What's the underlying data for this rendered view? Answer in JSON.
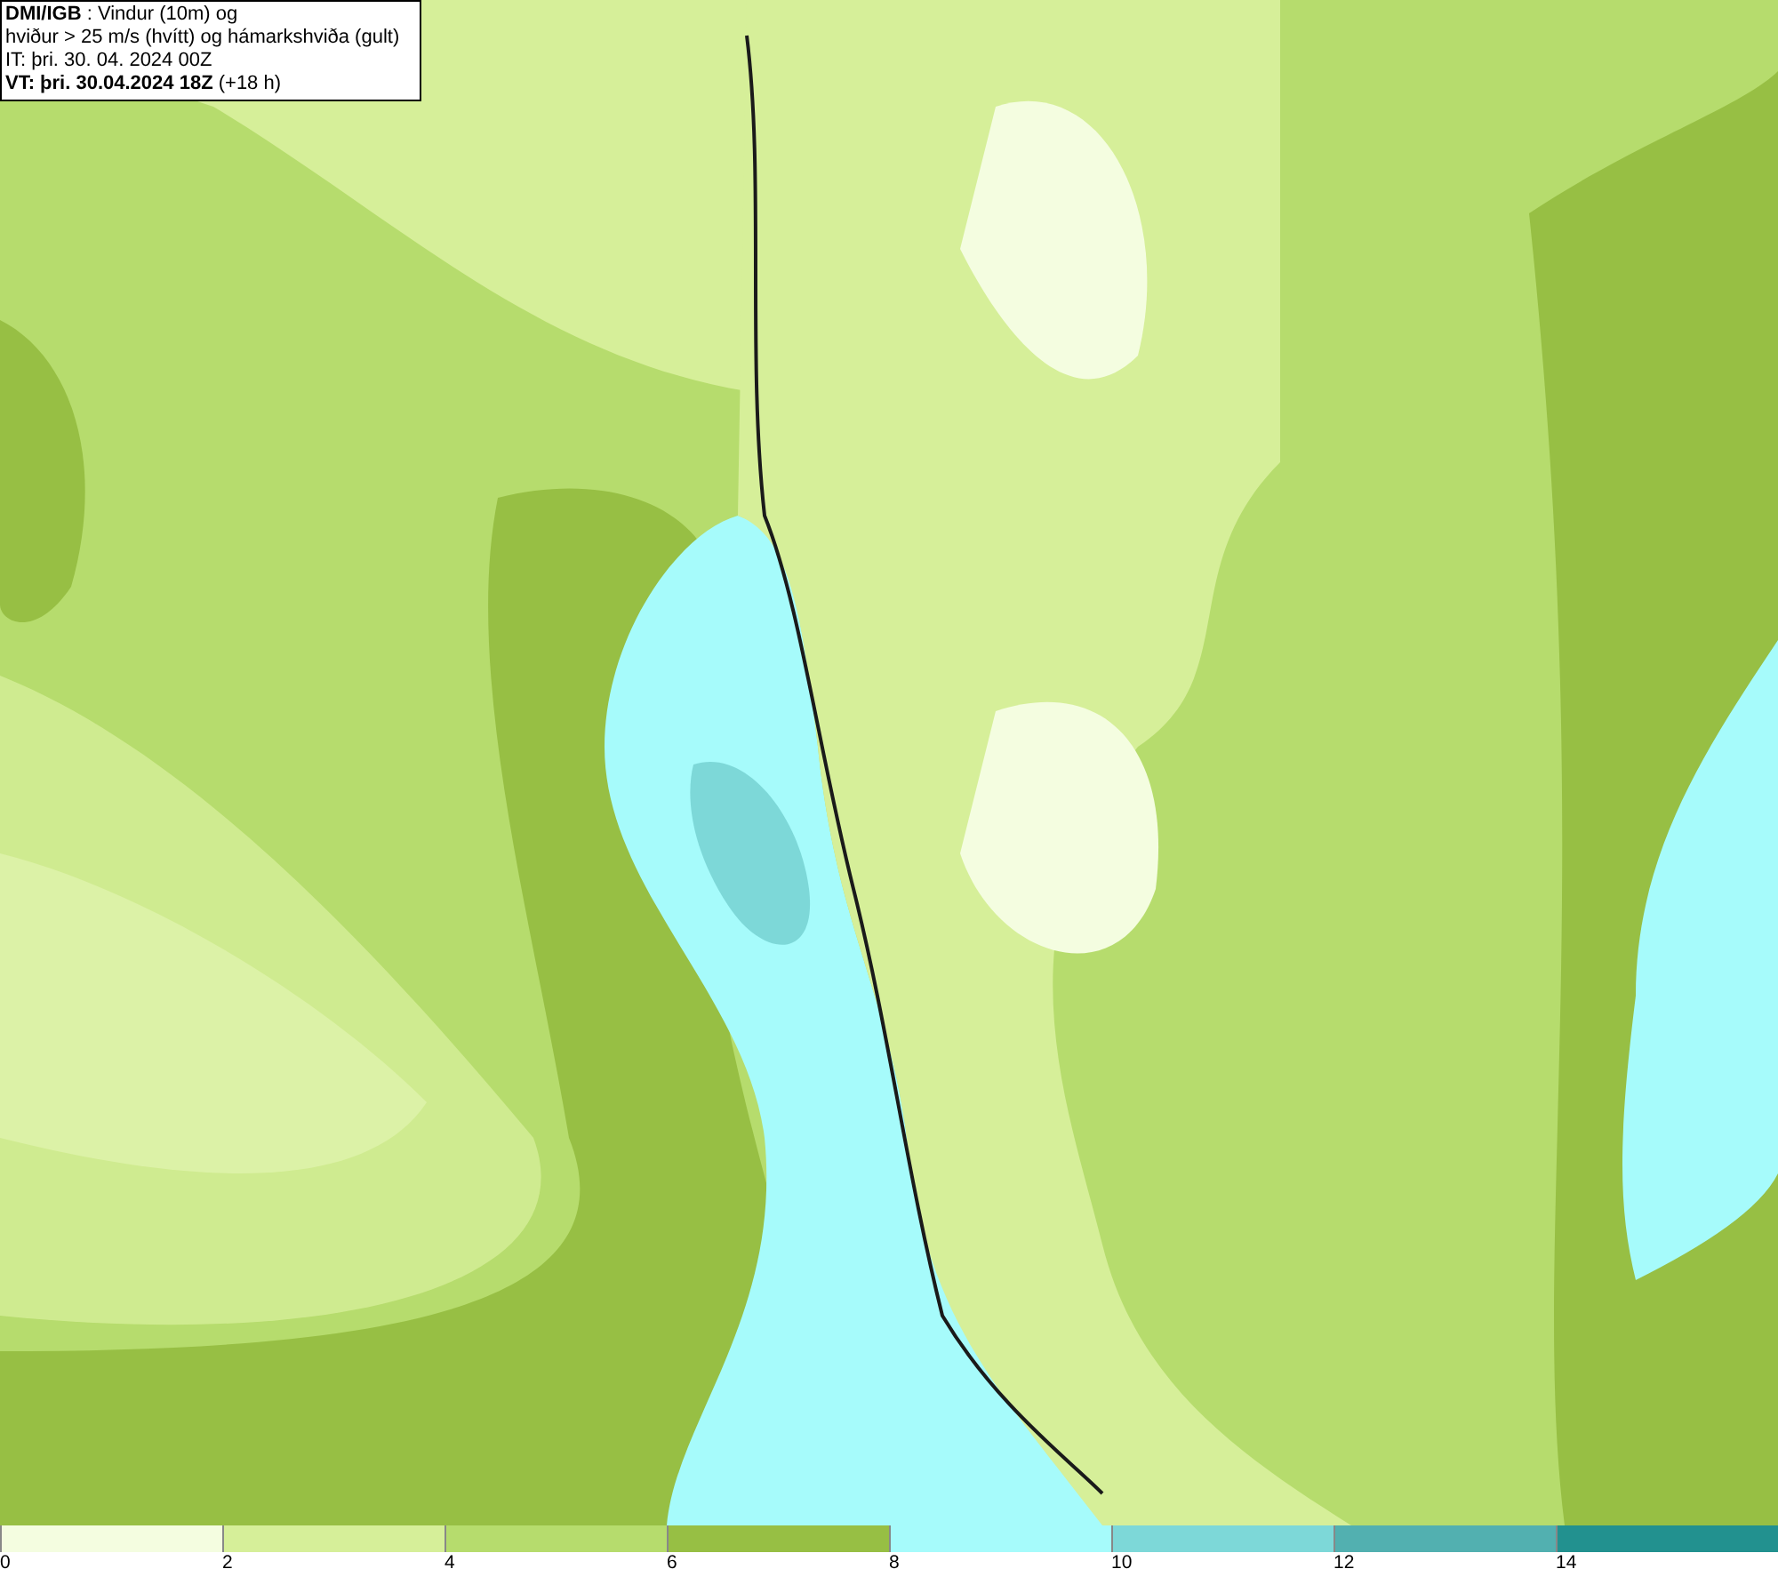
{
  "info_box": {
    "lines": [
      "**DMI/IGB** : Vindur (10m) og",
      "hviður > 25 m/s (hvítt) og hámarkshviða (gult)",
      "IT: þri. 30. 04. 2024 00Z",
      "**VT: þri. 30.04.2024 18Z** (+18 h)"
    ]
  },
  "legend": {
    "swatches": [
      {
        "color": "#f4fde0"
      },
      {
        "color": "#d6ef99"
      },
      {
        "color": "#b6dc6d"
      },
      {
        "color": "#97bf44"
      },
      {
        "color": "#a6fbfb"
      },
      {
        "color": "#7dd8d8"
      },
      {
        "color": "#52b0b0"
      },
      {
        "color": "#22918f"
      }
    ],
    "ticks": [
      "0",
      "2",
      "4",
      "6",
      "8",
      "10",
      "12",
      "14"
    ]
  }
}
